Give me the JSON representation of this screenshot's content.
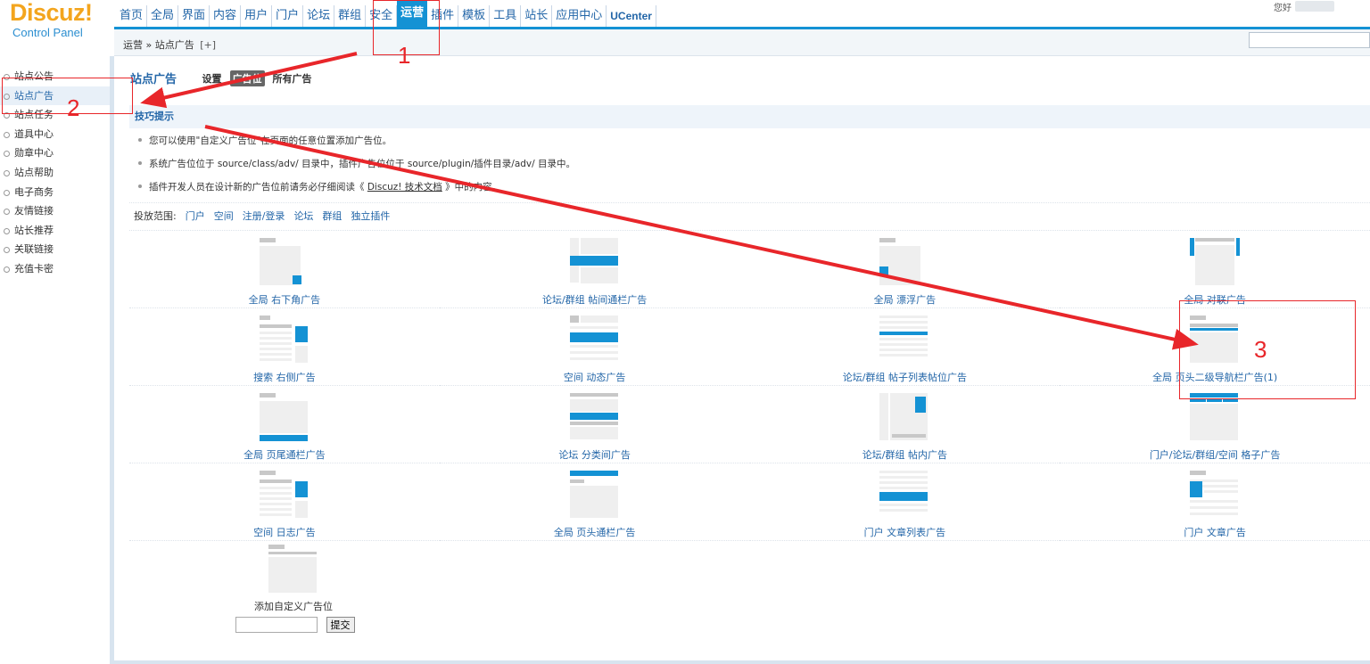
{
  "logo": {
    "brand": "Discuz!",
    "subtitle": "Control Panel"
  },
  "topnav": {
    "items": [
      "首页",
      "全局",
      "界面",
      "内容",
      "用户",
      "门户",
      "论坛",
      "群组",
      "安全",
      "运营",
      "插件",
      "模板",
      "工具",
      "站长",
      "应用中心",
      "UCenter"
    ],
    "active_index": 9,
    "greeting": "您好"
  },
  "breadcrumb": {
    "text": "运营 » 站点广告",
    "plus": "[+]"
  },
  "sidebar": {
    "items": [
      "站点公告",
      "站点广告",
      "站点任务",
      "道具中心",
      "勋章中心",
      "站点帮助",
      "电子商务",
      "友情链接",
      "站长推荐",
      "关联链接",
      "充值卡密"
    ],
    "active_index": 1
  },
  "main": {
    "title": "站点广告",
    "tabs": [
      "设置",
      "广告位",
      "所有广告"
    ],
    "active_tab": 1,
    "tips": {
      "heading": "技巧提示",
      "items": [
        {
          "text": "您可以使用\"自定义广告位\"在页面的任意位置添加广告位。"
        },
        {
          "text": "系统广告位位于 source/class/adv/ 目录中，插件广告位位于 source/plugin/插件目录/adv/ 目录中。"
        },
        {
          "pre": "插件开发人员在设计新的广告位前请务必仔细阅读《 ",
          "link": "Discuz! 技术文档",
          "post": " 》中的内容。"
        }
      ]
    },
    "range": {
      "label": "投放范围:",
      "links": [
        "门户",
        "空间",
        "注册/登录",
        "论坛",
        "群组",
        "独立插件"
      ]
    },
    "ads": [
      {
        "label": "全局 右下角广告",
        "icon": "corner-ad-icon"
      },
      {
        "label": "论坛/群组 帖间通栏广告",
        "icon": "post-banner-ad-icon"
      },
      {
        "label": "全局 漂浮广告",
        "icon": "float-ad-icon"
      },
      {
        "label": "全局 对联广告",
        "icon": "couplet-ad-icon"
      },
      {
        "label": "搜索 右侧广告",
        "icon": "search-right-ad-icon"
      },
      {
        "label": "空间 动态广告",
        "icon": "feed-ad-icon"
      },
      {
        "label": "论坛/群组 帖子列表帖位广告",
        "icon": "thread-list-ad-icon"
      },
      {
        "label": "全局 页头二级导航栏广告(1)",
        "icon": "subnav-ad-icon"
      },
      {
        "label": "全局 页尾通栏广告",
        "icon": "footer-banner-ad-icon"
      },
      {
        "label": "论坛 分类间广告",
        "icon": "category-ad-icon"
      },
      {
        "label": "论坛/群组 帖内广告",
        "icon": "in-post-ad-icon"
      },
      {
        "label": "门户/论坛/群组/空间 格子广告",
        "icon": "grid-ad-icon"
      },
      {
        "label": "空间 日志广告",
        "icon": "blog-ad-icon"
      },
      {
        "label": "全局 页头通栏广告",
        "icon": "header-banner-ad-icon"
      },
      {
        "label": "门户 文章列表广告",
        "icon": "article-list-ad-icon"
      },
      {
        "label": "门户 文章广告",
        "icon": "article-ad-icon"
      }
    ],
    "custom": {
      "label": "添加自定义广告位",
      "submit": "提交"
    }
  },
  "annotations": [
    "1",
    "2",
    "3"
  ],
  "colors": {
    "accent": "#1492d4",
    "link": "#2366a8",
    "annotation": "#e8262a",
    "logo": "#f3a51e"
  }
}
